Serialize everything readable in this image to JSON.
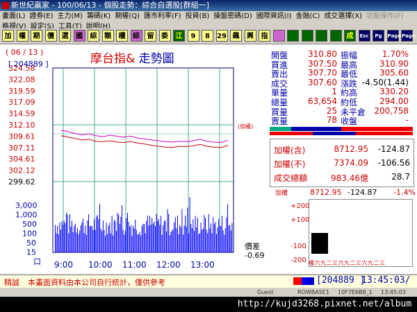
{
  "window": {
    "title": "新世紀贏家 - 100/06/13 - 個股走勢：綜合自選股[群組一]"
  },
  "menu_row1": [
    "畫面(L)",
    "證券(E)",
    "主力(M)",
    "籌碼(K)",
    "期權(Q)",
    "匯市利率(F)",
    "投資(B)",
    "操盤密碼(D)",
    "國際資訊(I)",
    "金融(C)",
    "成交選擇(X)",
    "功能操作(F)"
  ],
  "menu_row2": [
    "格視(V)",
    "設定(S)",
    "工具(T)",
    "說明(H)"
  ],
  "toolbar": [
    {
      "label": "加",
      "style": "y"
    },
    {
      "label": "權",
      "style": "y"
    },
    {
      "label": "期",
      "style": "y"
    },
    {
      "label": "價",
      "style": "y"
    },
    {
      "label": "選",
      "style": "y"
    },
    {
      "label": "國",
      "style": "p"
    },
    {
      "label": "綜",
      "style": "y"
    },
    {
      "label": "類",
      "style": "y"
    },
    {
      "label": "櫃",
      "style": "y"
    },
    {
      "label": "綜",
      "style": "p"
    },
    {
      "label": "留",
      "style": "y"
    },
    {
      "label": "委",
      "style": "y"
    },
    {
      "label": "江",
      "style": "g"
    },
    {
      "label": "9",
      "style": "y"
    },
    {
      "label": "8",
      "style": "y"
    },
    {
      "label": "29",
      "style": "y"
    },
    {
      "label": "飆",
      "style": "y"
    },
    {
      "label": "興",
      "style": "y"
    },
    {
      "label": "指",
      "style": "y"
    },
    {
      "label": "",
      "style": "p"
    },
    {
      "label": "",
      "style": "g"
    },
    {
      "label": "",
      "style": "g"
    },
    {
      "label": "",
      "style": "g"
    },
    {
      "label": "",
      "style": "g"
    },
    {
      "label": "成",
      "style": "g"
    },
    {
      "label": "Esc",
      "style": "b"
    },
    {
      "label": "Pg",
      "style": "b"
    },
    {
      "label": "Page",
      "style": "b"
    },
    {
      "label": "Page",
      "style": "b"
    }
  ],
  "header": {
    "date": "( 06 / 13 )",
    "code": "[ 204889 ]",
    "title_a": "摩台指&",
    "title_b": "走勢圖",
    "ref_label": "(加權)"
  },
  "chart_data": {
    "type": "line",
    "price_ticks": [
      324.58,
      322.08,
      319.59,
      317.09,
      314.59,
      312.1,
      309.61,
      307.11,
      304.61,
      302.12,
      299.62
    ],
    "reference": 312.1,
    "ylim": [
      299.62,
      324.58
    ],
    "volume_ticks": [
      "3,000",
      "1,000",
      "500",
      "100",
      "50",
      "15",
      "口"
    ],
    "time_ticks": [
      "9:00",
      "10:00",
      "11:00",
      "12:00",
      "13:00"
    ],
    "series": [
      {
        "values": [
          309.7,
          309.4,
          309.1,
          308.8,
          308.9,
          308.5,
          308.4,
          308.6,
          308.3,
          308.2,
          308.4,
          308.1,
          307.9,
          307.6,
          307.4,
          307.2,
          307.1,
          307.4,
          307.3,
          307.5,
          307.8,
          307.4,
          307.2,
          307.1,
          307.6
        ]
      },
      {
        "values": [
          310.9,
          310.6,
          310.2,
          309.9,
          310.1,
          309.7,
          309.5,
          309.8,
          309.6,
          309.4,
          309.6,
          309.2,
          309.0,
          308.8,
          308.6,
          308.4,
          308.3,
          308.5,
          308.4,
          308.6,
          308.9,
          308.5,
          308.3,
          308.2,
          308.7
        ]
      }
    ]
  },
  "diff": {
    "label": "價差",
    "value": "-0.69"
  },
  "quote": {
    "rows": [
      {
        "l1": "開盤",
        "v1": "310.80",
        "l2": "振幅",
        "v2": "1.70%"
      },
      {
        "l1": "買進",
        "v1": "307.50",
        "l2": "最高",
        "v2": "310.90"
      },
      {
        "l1": "賣出",
        "v1": "307.70",
        "l2": "最低",
        "v2": "305.60"
      },
      {
        "l1": "成交",
        "v1": "307.60",
        "l2": "漲跌",
        "v2": "-4.50(1.44)"
      },
      {
        "l1": "單量",
        "v1": "1",
        "l2": "約高",
        "v2": "330.20"
      },
      {
        "l1": "總量",
        "v1": "63,654",
        "l2": "約低",
        "v2": "294.00"
      },
      {
        "l1": "買量",
        "v1": "25",
        "l2": "未平倉",
        "v2": "200,758"
      },
      {
        "l1": "賣量",
        "v1": "78",
        "l2": "收盤",
        "v2": "-"
      }
    ],
    "idx": [
      {
        "label": "加權(含)",
        "value": "8712.95",
        "chg": "-124.87"
      },
      {
        "label": "加權(不)",
        "value": "7374.09",
        "chg": "-106.56"
      },
      {
        "label": "成交總額",
        "value": "983.46億",
        "chg": "28.7"
      }
    ],
    "mini": {
      "label": "加權",
      "value": "8712.95",
      "chg": "-124.87",
      "pct": "-1.4%",
      "ticks": [
        "+200",
        "+100",
        "-100",
        "-200"
      ],
      "xlabels": "權六九二三六九二三六九二三"
    }
  },
  "bottom": {
    "tag": "精誠",
    "notice": "本畫面資料由本公司自行統計，僅供參考",
    "code": "[204889 ]",
    "time": "13:45:03/"
  },
  "status": {
    "user": "Guest",
    "a": "ROWBASE1",
    "b": "10F7E6B8_1",
    "c": "13:45:03"
  },
  "url": "http://kujd3268.pixnet.net/album"
}
